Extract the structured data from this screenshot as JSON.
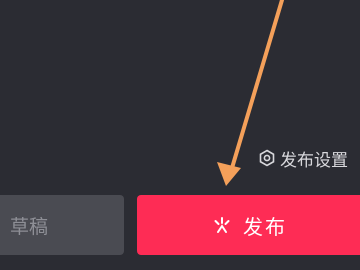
{
  "settings": {
    "label": "发布设置",
    "icon": "settings-hexagon-icon"
  },
  "draft_button": {
    "label": "草稿"
  },
  "publish_button": {
    "label": "发布",
    "icon": "spark-icon"
  },
  "colors": {
    "background": "#2b2c33",
    "publish": "#fe2c55",
    "draft": "#4a4b52",
    "annotation_arrow": "#f4a05a"
  },
  "annotation": {
    "icon": "arrow-pointer-icon"
  }
}
